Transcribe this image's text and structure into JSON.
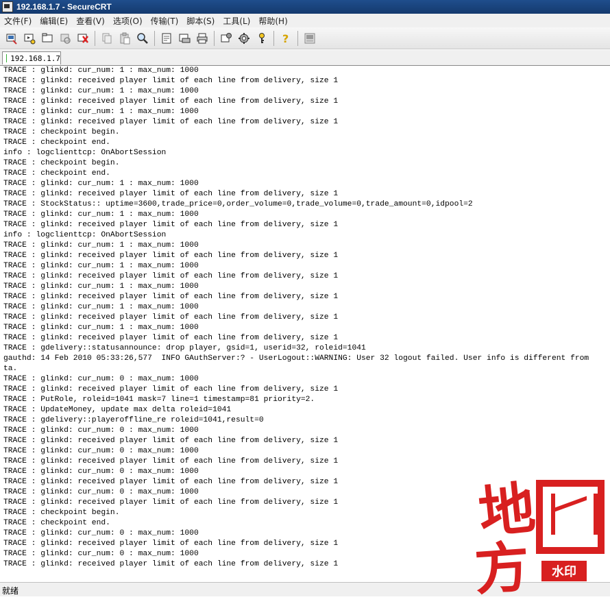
{
  "window": {
    "title": "192.168.1.7 - SecureCRT"
  },
  "menubar": {
    "items": [
      "文件(F)",
      "编辑(E)",
      "查看(V)",
      "选项(O)",
      "传输(T)",
      "脚本(S)",
      "工具(L)",
      "帮助(H)"
    ]
  },
  "toolbar": {
    "icons": [
      "connect-icon",
      "quick-connect-icon",
      "connect-tab-icon",
      "reconnect-icon",
      "disconnect-icon",
      "copy-icon",
      "paste-icon",
      "find-icon",
      "print-setup-icon",
      "print-selection-icon",
      "print-icon",
      "session-options-icon",
      "global-options-icon",
      "keymap-icon",
      "help-icon",
      "about-icon"
    ]
  },
  "tab": {
    "label": "192.168.1.7",
    "status_color": "#35b035"
  },
  "terminal": {
    "lines": [
      "TRACE : glinkd: cur_num: 1 : max_num: 1000",
      "TRACE : glinkd: received player limit of each line from delivery, size 1",
      "TRACE : glinkd: cur_num: 1 : max_num: 1000",
      "TRACE : glinkd: received player limit of each line from delivery, size 1",
      "TRACE : glinkd: cur_num: 1 : max_num: 1000",
      "TRACE : glinkd: received player limit of each line from delivery, size 1",
      "TRACE : checkpoint begin.",
      "TRACE : checkpoint end.",
      "info : logclienttcp: OnAbortSession",
      "TRACE : checkpoint begin.",
      "TRACE : checkpoint end.",
      "TRACE : glinkd: cur_num: 1 : max_num: 1000",
      "TRACE : glinkd: received player limit of each line from delivery, size 1",
      "TRACE : StockStatus:: uptime=3600,trade_price=0,order_volume=0,trade_volume=0,trade_amount=0,idpool=2",
      "TRACE : glinkd: cur_num: 1 : max_num: 1000",
      "TRACE : glinkd: received player limit of each line from delivery, size 1",
      "info : logclienttcp: OnAbortSession",
      "TRACE : glinkd: cur_num: 1 : max_num: 1000",
      "TRACE : glinkd: received player limit of each line from delivery, size 1",
      "TRACE : glinkd: cur_num: 1 : max_num: 1000",
      "TRACE : glinkd: received player limit of each line from delivery, size 1",
      "TRACE : glinkd: cur_num: 1 : max_num: 1000",
      "TRACE : glinkd: received player limit of each line from delivery, size 1",
      "TRACE : glinkd: cur_num: 1 : max_num: 1000",
      "TRACE : glinkd: received player limit of each line from delivery, size 1",
      "TRACE : glinkd: cur_num: 1 : max_num: 1000",
      "TRACE : glinkd: received player limit of each line from delivery, size 1",
      "TRACE : gdelivery::statusannounce: drop player, gsid=1, userid=32, roleid=1041",
      "gauthd: 14 Feb 2010 05:33:26,577  INFO GAuthServer:? - UserLogout::WARNING: User 32 logout failed. User info is different from",
      "ta.",
      "TRACE : glinkd: cur_num: 0 : max_num: 1000",
      "TRACE : glinkd: received player limit of each line from delivery, size 1",
      "TRACE : PutRole, roleid=1041 mask=7 line=1 timestamp=81 priority=2.",
      "TRACE : UpdateMoney, update max delta roleid=1041",
      "TRACE : gdelivery::playeroffline_re roleid=1041,result=0",
      "TRACE : glinkd: cur_num: 0 : max_num: 1000",
      "TRACE : glinkd: received player limit of each line from delivery, size 1",
      "TRACE : glinkd: cur_num: 0 : max_num: 1000",
      "TRACE : glinkd: received player limit of each line from delivery, size 1",
      "TRACE : glinkd: cur_num: 0 : max_num: 1000",
      "TRACE : glinkd: received player limit of each line from delivery, size 1",
      "TRACE : glinkd: cur_num: 0 : max_num: 1000",
      "TRACE : glinkd: received player limit of each line from delivery, size 1",
      "TRACE : checkpoint begin.",
      "TRACE : checkpoint end.",
      "TRACE : glinkd: cur_num: 0 : max_num: 1000",
      "TRACE : glinkd: received player limit of each line from delivery, size 1",
      "TRACE : glinkd: cur_num: 0 : max_num: 1000",
      "TRACE : glinkd: received player limit of each line from delivery, size 1"
    ]
  },
  "statusbar": {
    "text": "就绪"
  },
  "watermark": {
    "text": "地方网",
    "stamp": "水印",
    "color": "#d82020"
  }
}
